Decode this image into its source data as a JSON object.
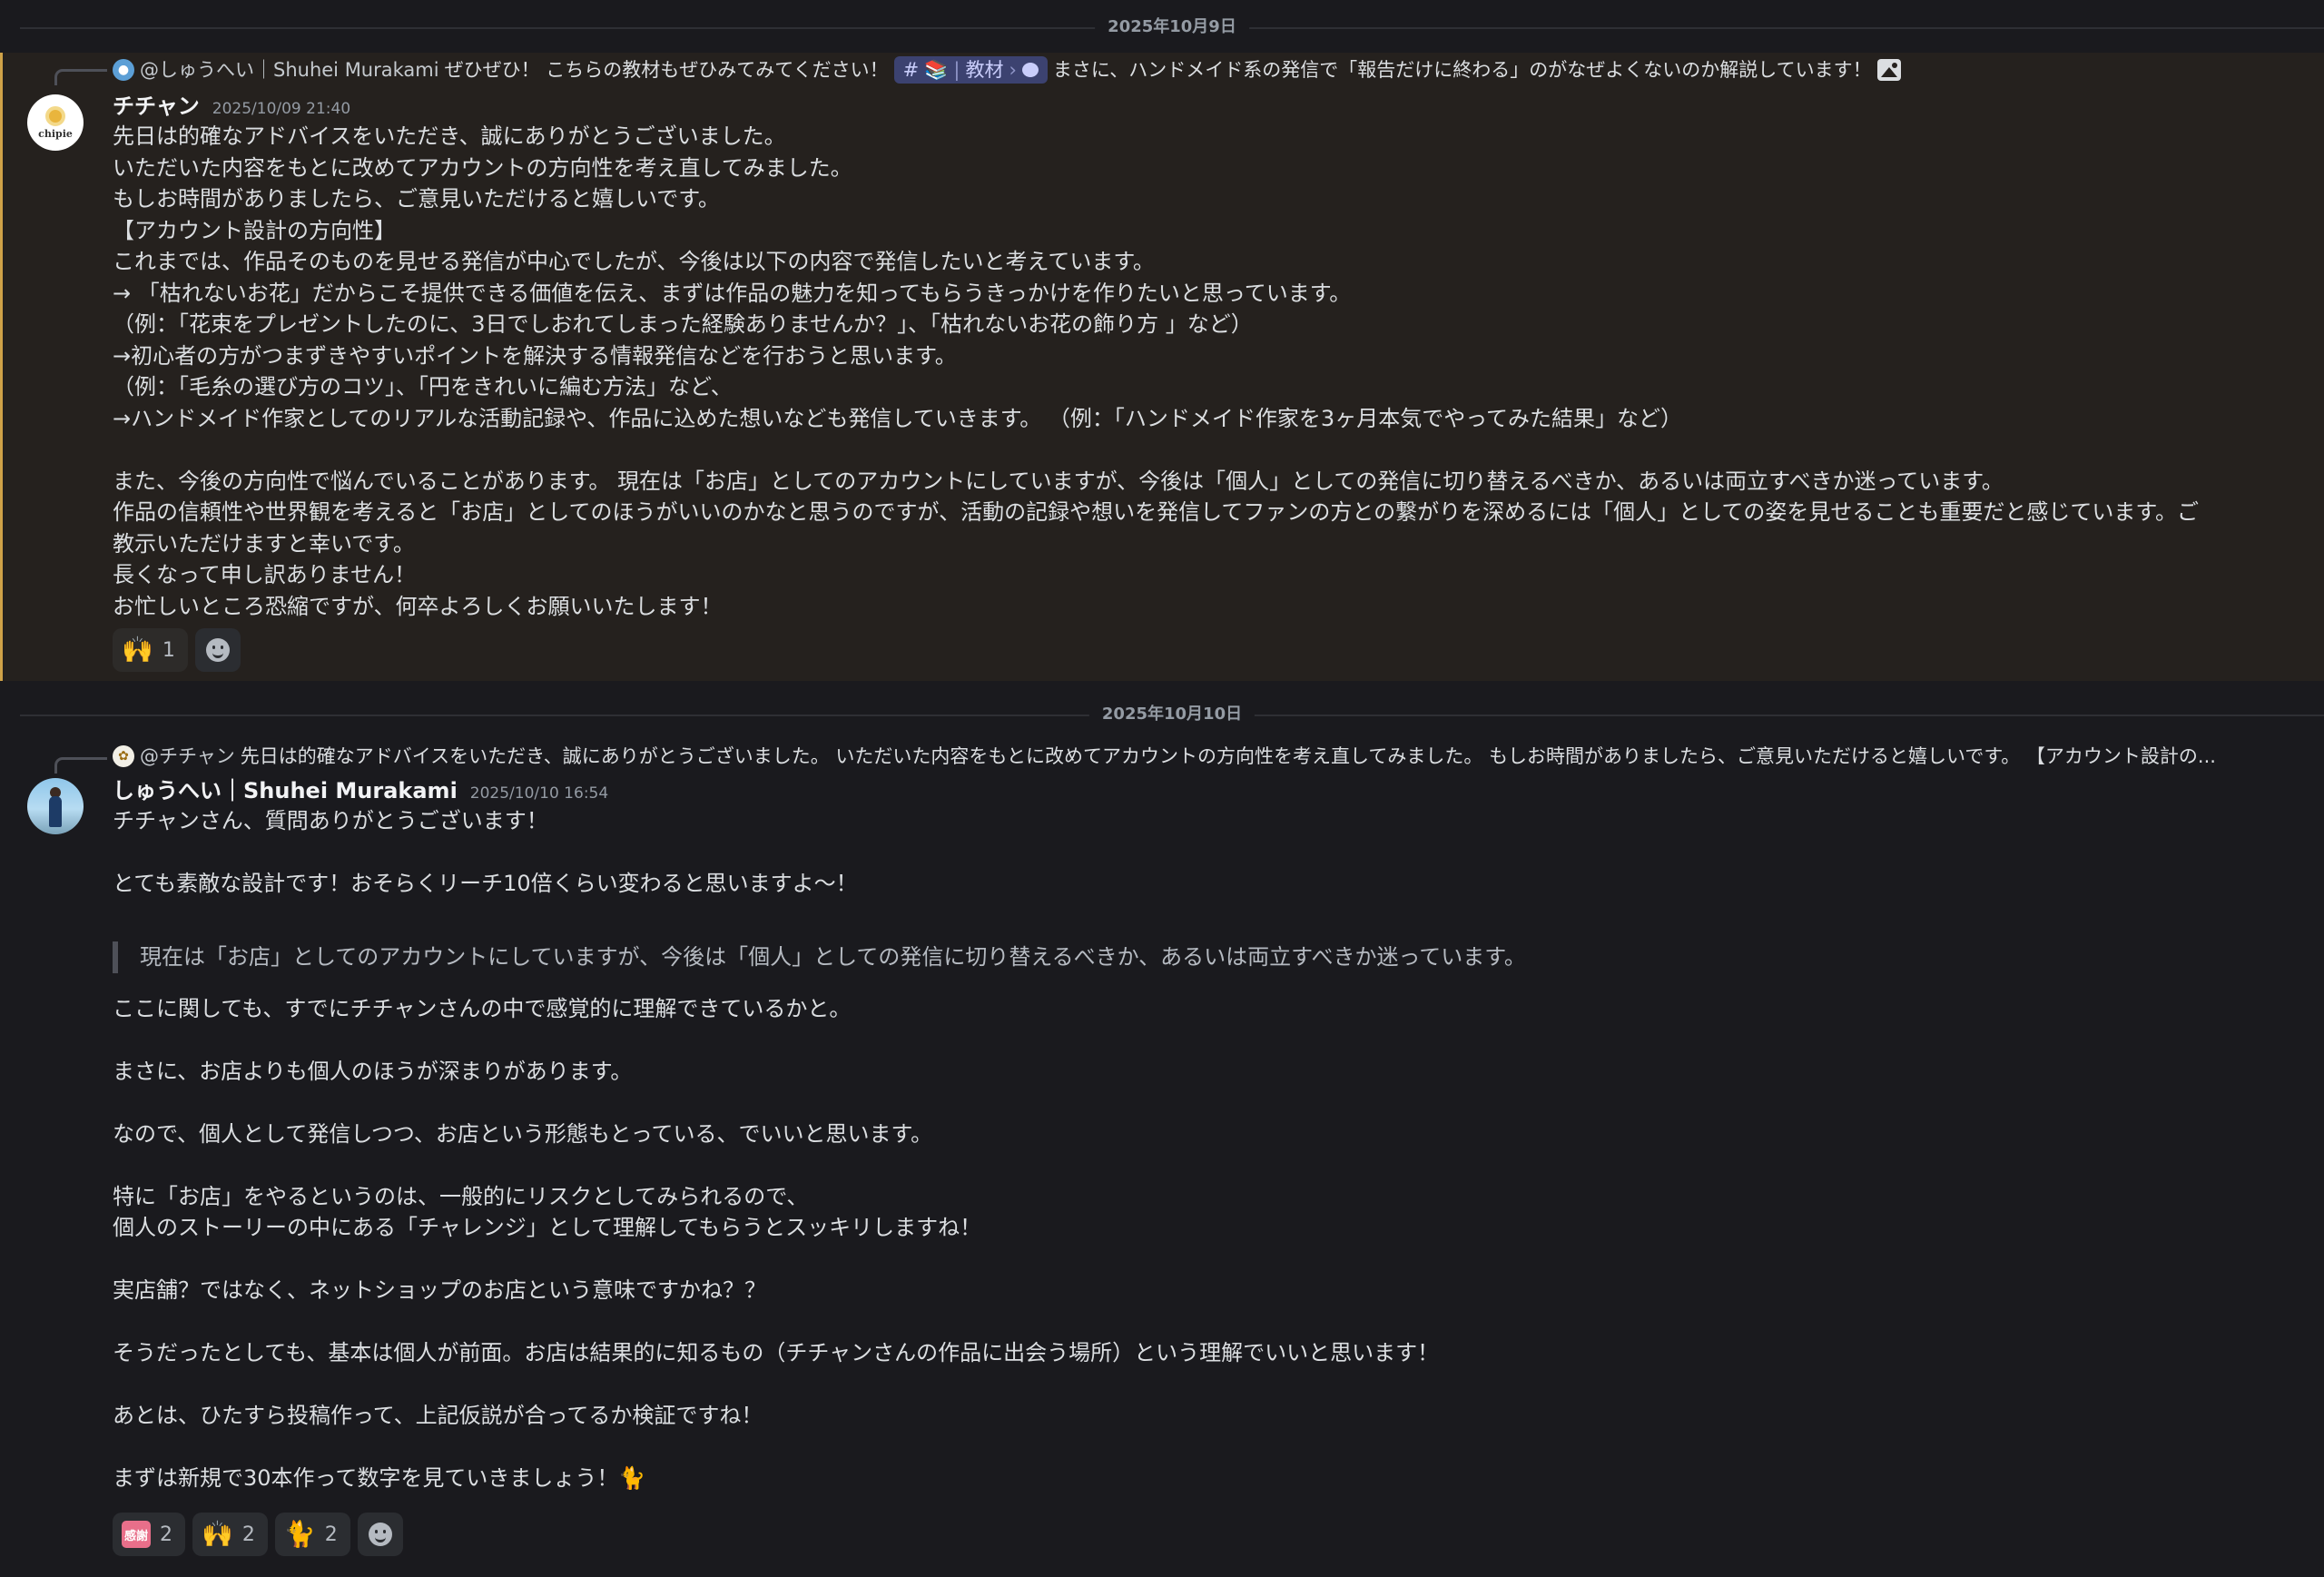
{
  "dividers": {
    "first": "2025年10月9日",
    "second": "2025年10月10日"
  },
  "message1": {
    "reply": {
      "mention": "@しゅうへい｜Shuhei Murakami",
      "text_before": "ぜひぜひ！ こちらの教材もぜひみてみてください！",
      "channel": {
        "hash": "#",
        "emoji": "📚",
        "sep": "|",
        "name": "教材",
        "arrow": "›"
      },
      "text_after": "まさに、ハンドメイド系の発信で「報告だけに終わる」のがなぜよくないのか解説しています！"
    },
    "avatar_text": "chipie",
    "author": "チチャン",
    "timestamp": "2025/10/09 21:40",
    "lines": [
      "先日は的確なアドバイスをいただき、誠にありがとうございました。",
      "いただいた内容をもとに改めてアカウントの方向性を考え直してみました。",
      "もしお時間がありましたら、ご意見いただけると嬉しいです。",
      "【アカウント設計の方向性】",
      "これまでは、作品そのものを見せる発信が中心でしたが、今後は以下の内容で発信したいと考えています。",
      "→ 「枯れないお花」だからこそ提供できる価値を伝え、まずは作品の魅力を知ってもらうきっかけを作りたいと思っています。",
      "（例：「花束をプレゼントしたのに、3日でしおれてしまった経験ありませんか？」、「枯れないお花の飾り方 」など）",
      "→初心者の方がつまずきやすいポイントを解決する情報発信などを行おうと思います。",
      "（例：「毛糸の選び方のコツ」、「円をきれいに編む方法」など、",
      "→ハンドメイド作家としてのリアルな活動記録や、作品に込めた想いなども発信していきます。 （例：「ハンドメイド作家を3ヶ月本気でやってみた結果」など）",
      "",
      "また、今後の方向性で悩んでいることがあります。 現在は「お店」としてのアカウントにしていますが、今後は「個人」としての発信に切り替えるべきか、あるいは両立すべきか迷っています。",
      "作品の信頼性や世界観を考えると「お店」としてのほうがいいのかなと思うのですが、活動の記録や想いを発信してファンの方との繋がりを深めるには「個人」としての姿を見せることも重要だと感じています。ご",
      "教示いただけますと幸いです。",
      "長くなって申し訳ありません！",
      "お忙しいところ恐縮ですが、何卒よろしくお願いいたします！"
    ],
    "reactions": [
      {
        "emoji": "🙌",
        "count": "1"
      }
    ]
  },
  "message2": {
    "reply": {
      "mention": "@チチャン",
      "text": "先日は的確なアドバイスをいただき、誠にありがとうございました。 いただいた内容をもとに改めてアカウントの方向性を考え直してみました。 もしお時間がありましたら、ご意見いただけると嬉しいです。 【アカウント設計の..."
    },
    "author": "しゅうへい｜Shuhei Murakami",
    "timestamp": "2025/10/10 16:54",
    "lines_before_quote": [
      "チチャンさん、質問ありがとうございます！",
      "",
      "とても素敵な設計です！おそらくリーチ10倍くらい変わると思いますよ〜！"
    ],
    "quote": "現在は「お店」としてのアカウントにしていますが、今後は「個人」としての発信に切り替えるべきか、あるいは両立すべきか迷っています。",
    "lines_after_quote": [
      "ここに関しても、すでにチチャンさんの中で感覚的に理解できているかと。",
      "",
      "まさに、お店よりも個人のほうが深まりがあります。",
      "",
      "なので、個人として発信しつつ、お店という形態もとっている、でいいと思います。",
      "",
      "特に「お店」をやるというのは、一般的にリスクとしてみられるので、",
      "個人のストーリーの中にある「チャレンジ」として理解してもらうとスッキリしますね！",
      "",
      "実店舗？ではなく、ネットショップのお店という意味ですかね？？",
      "",
      "そうだったとしても、基本は個人が前面。お店は結果的に知るもの（チチャンさんの作品に出会う場所）という理解でいいと思います！",
      "",
      "あとは、ひたすら投稿作って、上記仮説が合ってるか検証ですね！",
      "",
      "まずは新規で30本作って数字を見ていきましょう！🐈"
    ],
    "reactions": [
      {
        "emoji": "感謝",
        "count": "2"
      },
      {
        "emoji": "🙌",
        "count": "2"
      },
      {
        "emoji": "🐈",
        "count": "2"
      }
    ]
  },
  "icons": {
    "add_reaction": "smile-plus-icon",
    "attachment": "image-icon",
    "thread_bubble": "speech-bubble-icon"
  },
  "colors": {
    "background": "#1a1a1e",
    "mention_highlight": "#25211e",
    "mention_bar": "#cfa248",
    "channel_pill": "#3c4270"
  }
}
